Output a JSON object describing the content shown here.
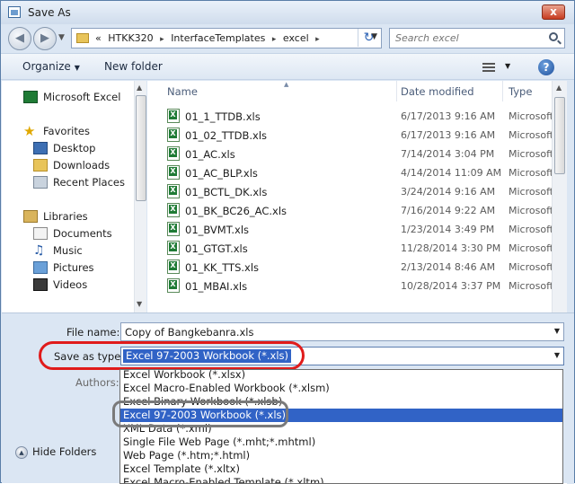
{
  "window": {
    "title": "Save As",
    "close_label": "x"
  },
  "address": {
    "overflow": "«",
    "crumbs": [
      "HTKK320",
      "InterfaceTemplates",
      "excel"
    ],
    "search_placeholder": "Search excel"
  },
  "toolbar": {
    "organize_label": "Organize",
    "new_folder_label": "New folder",
    "help_label": "?"
  },
  "nav": {
    "microsoft_excel": "Microsoft Excel",
    "favorites": "Favorites",
    "desktop": "Desktop",
    "downloads": "Downloads",
    "recent_places": "Recent Places",
    "libraries": "Libraries",
    "documents": "Documents",
    "music": "Music",
    "pictures": "Pictures",
    "videos": "Videos"
  },
  "columns": {
    "name": "Name",
    "date_modified": "Date modified",
    "type": "Type"
  },
  "files": [
    {
      "name": "01_1_TTDB.xls",
      "date": "6/17/2013 9:16 AM",
      "type": "Microsoft E"
    },
    {
      "name": "01_02_TTDB.xls",
      "date": "6/17/2013 9:16 AM",
      "type": "Microsoft E"
    },
    {
      "name": "01_AC.xls",
      "date": "7/14/2014 3:04 PM",
      "type": "Microsoft E"
    },
    {
      "name": "01_AC_BLP.xls",
      "date": "4/14/2014 11:09 AM",
      "type": "Microsoft E"
    },
    {
      "name": "01_BCTL_DK.xls",
      "date": "3/24/2014 9:16 AM",
      "type": "Microsoft E"
    },
    {
      "name": "01_BK_BC26_AC.xls",
      "date": "7/16/2014 9:22 AM",
      "type": "Microsoft E"
    },
    {
      "name": "01_BVMT.xls",
      "date": "1/23/2014 3:49 PM",
      "type": "Microsoft E"
    },
    {
      "name": "01_GTGT.xls",
      "date": "11/28/2014 3:30 PM",
      "type": "Microsoft E"
    },
    {
      "name": "01_KK_TTS.xls",
      "date": "2/13/2014 8:46 AM",
      "type": "Microsoft E"
    },
    {
      "name": "01_MBAI.xls",
      "date": "10/28/2014 3:37 PM",
      "type": "Microsoft E"
    }
  ],
  "form": {
    "file_name_label": "File name:",
    "file_name_value": "Copy of Bangkebanra.xls",
    "save_as_type_label": "Save as type:",
    "save_as_type_value": "Excel 97-2003 Workbook (*.xls)",
    "authors_label": "Authors:"
  },
  "type_options": [
    {
      "label": "Excel Workbook (*.xlsx)",
      "selected": false
    },
    {
      "label": "Excel Macro-Enabled Workbook (*.xlsm)",
      "selected": false
    },
    {
      "label": "Excel Binary Workbook (*.xlsb)",
      "selected": false
    },
    {
      "label": "Excel 97-2003 Workbook (*.xls)",
      "selected": true
    },
    {
      "label": "XML Data (*.xml)",
      "selected": false
    },
    {
      "label": "Single File Web Page (*.mht;*.mhtml)",
      "selected": false
    },
    {
      "label": "Web Page (*.htm;*.html)",
      "selected": false
    },
    {
      "label": "Excel Template (*.xltx)",
      "selected": false
    },
    {
      "label": "Excel Macro-Enabled Template (*.xltm)",
      "selected": false
    }
  ],
  "footer": {
    "hide_folders_label": "Hide Folders"
  },
  "colors": {
    "selection": "#3163c6",
    "annotation_red": "#e01b1b",
    "annotation_gray": "#7a7a7a"
  }
}
